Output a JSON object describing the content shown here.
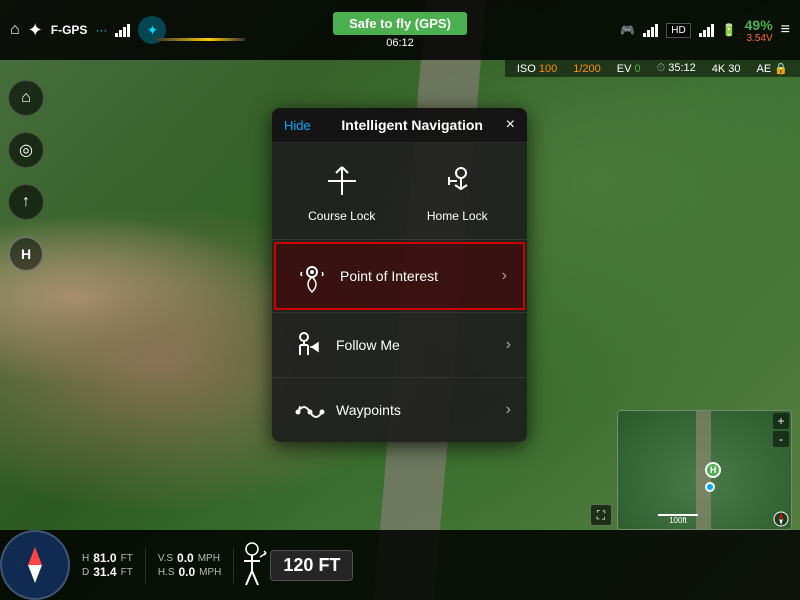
{
  "topBar": {
    "homeIcon": "⌂",
    "droneIcon": "✦",
    "gpsLabel": "F-GPS",
    "signalIcon": "📶",
    "modeLabel": "···",
    "statusBtn": "Safe to fly (GPS)",
    "timer": "06:12",
    "hdLabel": "HD",
    "batteryPct": "49%",
    "batteryVolt": "3.54V",
    "menuIcon": "≡"
  },
  "infoBar": {
    "iso": "ISO",
    "isoVal": "100",
    "shutterVal": "1/200",
    "ev": "EV",
    "evVal": "0",
    "timeVal": "35:12",
    "resVal": "4K 30",
    "aeLabel": "AE"
  },
  "leftSidebar": {
    "icons": [
      "⊕",
      "◎",
      "↑"
    ]
  },
  "modal": {
    "hideLabel": "Hide",
    "title": "Intelligent Navigation",
    "closeIcon": "×",
    "navItems": [
      {
        "id": "course-lock",
        "icon": "✛",
        "label": "Course Lock"
      },
      {
        "id": "home-lock",
        "icon": "⌖",
        "label": "Home Lock"
      }
    ],
    "menuItems": [
      {
        "id": "poi",
        "label": "Point of Interest",
        "highlighted": true
      },
      {
        "id": "follow-me",
        "label": "Follow Me",
        "highlighted": false
      },
      {
        "id": "waypoints",
        "label": "Waypoints",
        "highlighted": false
      }
    ]
  },
  "bottomBar": {
    "altitudeLabel": "H",
    "altitudeVal": "81.0",
    "altitudeUnit": "FT",
    "distLabel": "D",
    "distVal": "31.4",
    "distUnit": "FT",
    "vsLabel": "V.S",
    "vsVal": "0.0",
    "vsUnit": "MPH",
    "hsLabel": "H.S",
    "hsVal": "0.0",
    "hsUnit": "MPH",
    "altBoxVal": "120 FT"
  },
  "miniMap": {
    "markerLabel": "H",
    "scaleLabel": "100ft"
  }
}
